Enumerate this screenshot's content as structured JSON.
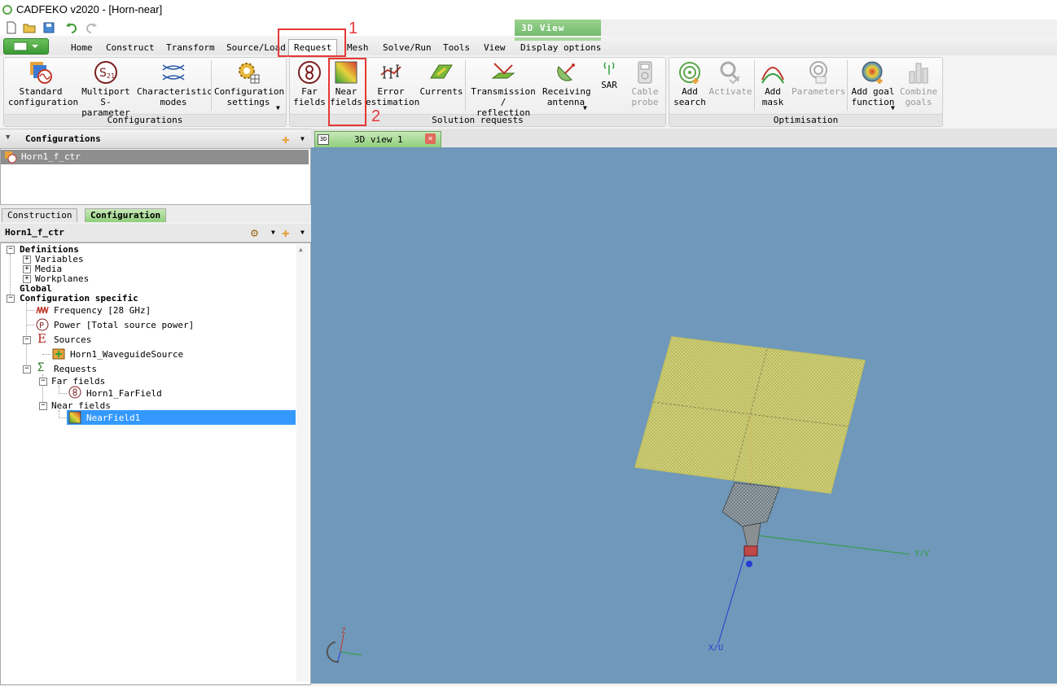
{
  "window": {
    "title": "CADFEKO v2020 - [Horn-near]"
  },
  "context_tab": {
    "label": "3D View"
  },
  "tabs": [
    "Home",
    "Construct",
    "Transform",
    "Source/Load",
    "Request",
    "Mesh",
    "Solve/Run",
    "Tools",
    "View",
    "Display options"
  ],
  "active_tab": "Request",
  "ribbon": {
    "groups": {
      "configurations": "Configurations",
      "solution_requests": "Solution requests",
      "optimisation": "Optimisation"
    },
    "buttons": {
      "standard_config": [
        "Standard",
        "configuration"
      ],
      "multiport": [
        "Multiport",
        "S-parameter"
      ],
      "char_modes": [
        "Characteristic",
        "modes"
      ],
      "config_settings": [
        "Configuration",
        "settings"
      ],
      "far_fields": [
        "Far",
        "fields"
      ],
      "near_fields": [
        "Near",
        "fields"
      ],
      "error_estimation": [
        "Error",
        "estimation"
      ],
      "currents": [
        "Currents"
      ],
      "trans_reflection": [
        "Transmission /",
        "reflection"
      ],
      "receiving_antenna": [
        "Receiving",
        "antenna"
      ],
      "sar": [
        "SAR"
      ],
      "cable_probe": [
        "Cable",
        "probe"
      ],
      "add_search": [
        "Add",
        "search"
      ],
      "activate": [
        "Activate"
      ],
      "add_mask": [
        "Add",
        "mask"
      ],
      "parameters": [
        "Parameters"
      ],
      "add_goal": [
        "Add goal",
        "function"
      ],
      "combine_goals": [
        "Combine",
        "goals"
      ]
    }
  },
  "annotations": {
    "box1": "1",
    "box2": "2"
  },
  "configurations_panel": {
    "title": "Configurations",
    "items": [
      "Horn1_f_ctr"
    ]
  },
  "left_tabs": [
    "Construction",
    "Configuration"
  ],
  "config_name": "Horn1_f_ctr",
  "tree": {
    "definitions": "Definitions",
    "variables": "Variables",
    "media": "Media",
    "workplanes": "Workplanes",
    "global": "Global",
    "config_specific": "Configuration specific",
    "frequency": "Frequency [28 GHz]",
    "power": "Power [Total source power]",
    "sources": "Sources",
    "waveguide_source": "Horn1_WaveguideSource",
    "requests": "Requests",
    "far_fields": "Far fields",
    "far_field_item": "Horn1_FarField",
    "near_fields": "Near fields",
    "near_field_item": "NearField1"
  },
  "view": {
    "tab_label": "3D view 1",
    "axes": {
      "y": "Y/V",
      "x": "X/U",
      "z": "Z"
    }
  },
  "colors": {
    "accent_green": "#6db86a",
    "selection": "#3399ff",
    "viewport_bg": "#6f98ba",
    "annotation": "#e53935"
  }
}
